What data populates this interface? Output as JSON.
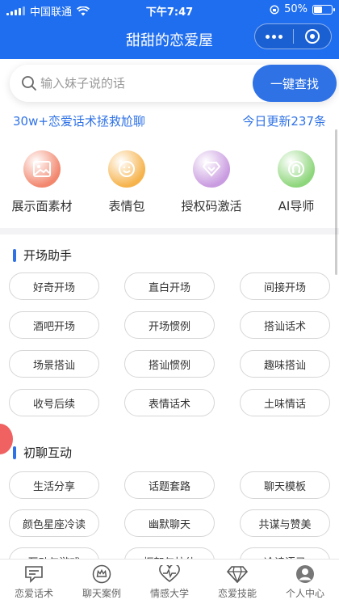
{
  "status_bar": {
    "carrier": "中国联通",
    "time": "下午7:47",
    "battery": "50%",
    "battery_fraction": 0.5
  },
  "nav": {
    "title": "甜甜的恋爱屋"
  },
  "search": {
    "placeholder": "输入妹子说的话",
    "button": "一键查找"
  },
  "promo": {
    "left": "30w+恋爱话术拯救尬聊",
    "right": "今日更新237条"
  },
  "quick_items": [
    {
      "label": "展示面素材",
      "icon": "image-icon",
      "color": "#f2876e"
    },
    {
      "label": "表情包",
      "icon": "smile-icon",
      "color": "#f6b34c"
    },
    {
      "label": "授权码激活",
      "icon": "diamond-icon",
      "color": "#c99be0"
    },
    {
      "label": "AI导师",
      "icon": "headset-icon",
      "color": "#8ed67c"
    }
  ],
  "sections": [
    {
      "title": "开场助手",
      "chips": [
        "好奇开场",
        "直白开场",
        "间接开场",
        "酒吧开场",
        "开场惯例",
        "搭讪话术",
        "场景搭讪",
        "搭讪惯例",
        "趣味搭讪",
        "收号后续",
        "表情话术",
        "土味情话"
      ]
    },
    {
      "title": "初聊互动",
      "chips": [
        "生活分享",
        "话题套路",
        "聊天模板",
        "颜色星座冷读",
        "幽默聊天",
        "共谋与赞美",
        "互动与游戏",
        "框架与拉伸",
        "冷读语录"
      ]
    }
  ],
  "tabs": [
    {
      "label": "恋爱话术",
      "icon": "chat-icon"
    },
    {
      "label": "聊天案例",
      "icon": "crown-icon"
    },
    {
      "label": "情感大学",
      "icon": "heart-icon"
    },
    {
      "label": "恋爱技能",
      "icon": "diamond-icon"
    },
    {
      "label": "个人中心",
      "icon": "user-icon"
    }
  ]
}
